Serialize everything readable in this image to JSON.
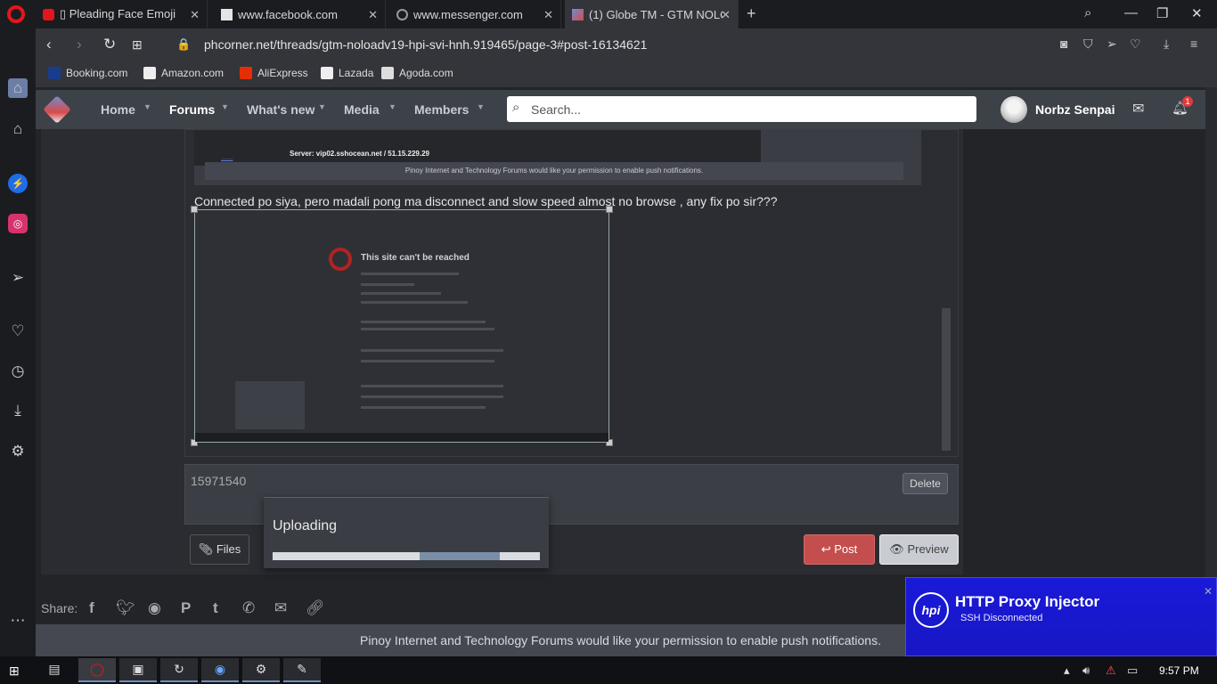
{
  "browser": {
    "tabs": [
      {
        "title": "▯ Pleading Face Emoji",
        "active": false
      },
      {
        "title": "www.facebook.com",
        "active": false
      },
      {
        "title": "www.messenger.com",
        "active": false
      },
      {
        "title": "(1) Globe TM - GTM NOLOA",
        "active": true
      }
    ],
    "url": "phcorner.net/threads/gtm-noloadv19-hpi-svi-hnh.919465/page-3#post-16134621",
    "bookmarks": [
      "Booking.com",
      "Amazon.com",
      "AliExpress",
      "Lazada",
      "Agoda.com"
    ]
  },
  "forum_nav": {
    "items": [
      "Home",
      "Forums",
      "What's new",
      "Media",
      "Members"
    ],
    "active": "Forums",
    "search_placeholder": "Search...",
    "username": "Norbz Senpai",
    "notification_count": "1"
  },
  "post": {
    "embed_server": "Server: vip02.sshocean.net / 51.15.229.29",
    "embed_push_text": "Pinoy Internet and Technology Forums would like your permission to enable push notifications.",
    "text": "Connected po siya, pero madali pong ma disconnect and slow speed almost no browse , any fix po sir???",
    "screenshot_title": "This site can't be reached"
  },
  "attachment": {
    "file_name": "15971540",
    "delete_label": "Delete"
  },
  "upload": {
    "title": "Uploading",
    "progress": 0.55,
    "buffer_end": 0.85
  },
  "actions": {
    "files_label": "Files",
    "post_label": "Post",
    "preview_label": "Preview"
  },
  "share": {
    "label": "Share:",
    "icons": [
      "facebook-icon",
      "twitter-icon",
      "reddit-icon",
      "pinterest-icon",
      "tumblr-icon",
      "whatsapp-icon",
      "email-icon",
      "link-icon"
    ]
  },
  "push_banner": "Pinoy Internet and Technology Forums would like your permission to enable push notifications.",
  "proxy_toast": {
    "logo": "hpi",
    "title": "HTTP Proxy Injector",
    "status": "SSH Disconnected"
  },
  "taskbar": {
    "clock": "9:57 PM"
  },
  "colors": {
    "post_button": "#c44e4e",
    "toast_background": "#1a19d8",
    "notification_badge": "#e03a3a"
  }
}
